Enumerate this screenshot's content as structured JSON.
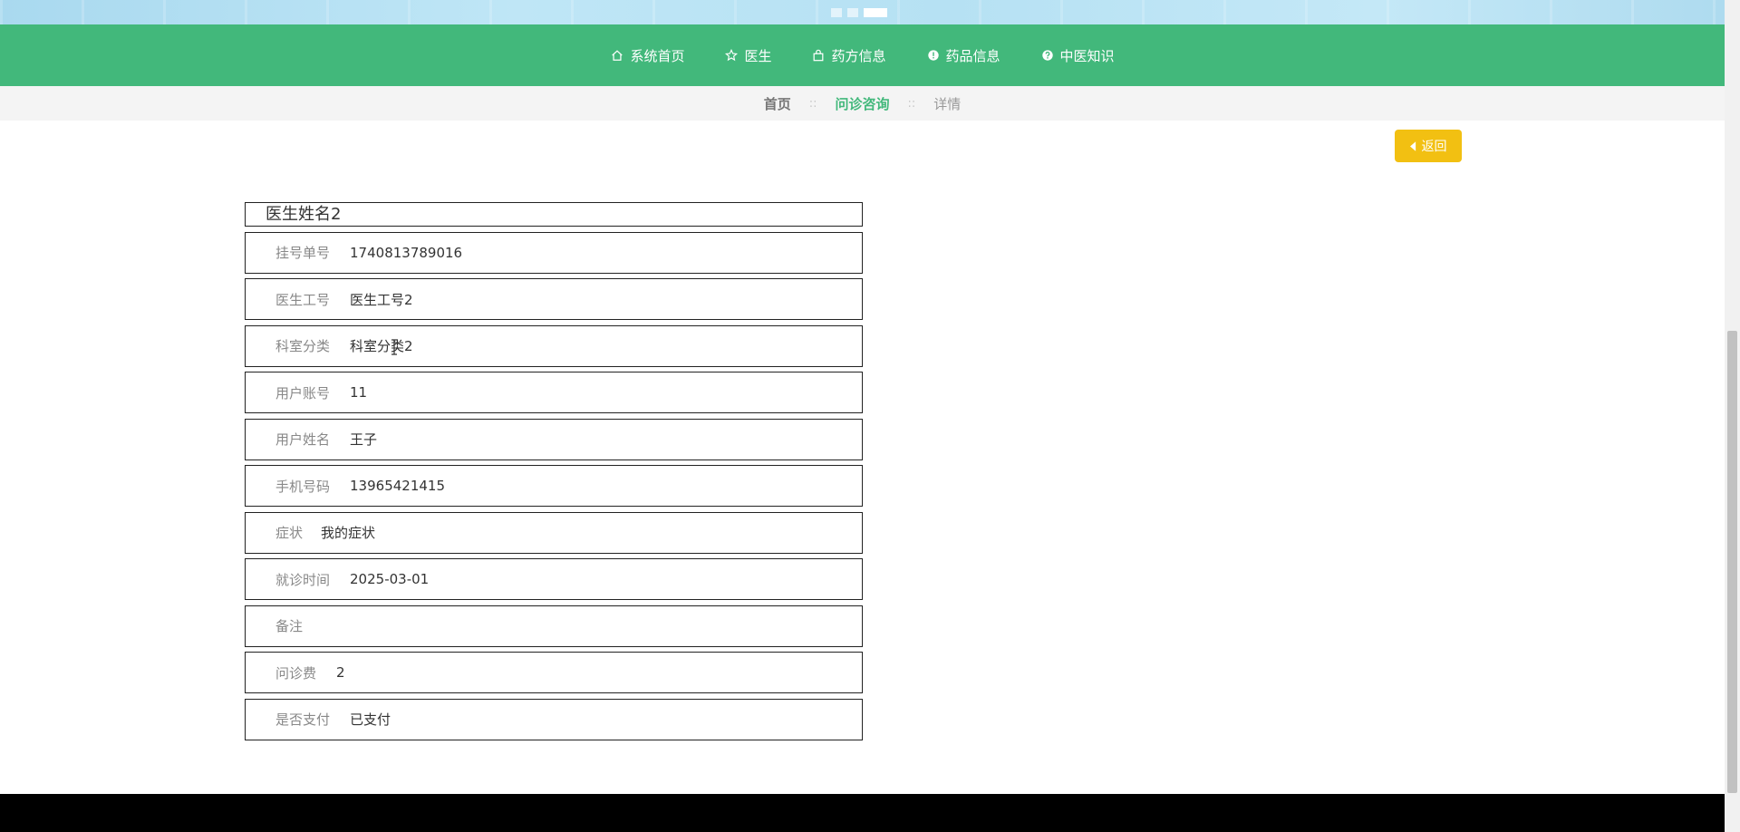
{
  "nav": {
    "items": [
      {
        "label": "系统首页",
        "icon": "home-icon"
      },
      {
        "label": "医生",
        "icon": "star-icon"
      },
      {
        "label": "药方信息",
        "icon": "bag-icon"
      },
      {
        "label": "药品信息",
        "icon": "exclamation-icon"
      },
      {
        "label": "中医知识",
        "icon": "question-icon"
      }
    ]
  },
  "breadcrumb": {
    "items": [
      "首页",
      "问诊咨询",
      "详情"
    ],
    "separator": "::"
  },
  "back_button": {
    "label": "返回"
  },
  "detail": {
    "title": "医生姓名2",
    "fields": [
      {
        "label": "挂号单号",
        "value": "1740813789016"
      },
      {
        "label": "医生工号",
        "value": "医生工号2"
      },
      {
        "label": "科室分类",
        "value": "科室分类2"
      },
      {
        "label": "用户账号",
        "value": "11"
      },
      {
        "label": "用户姓名",
        "value": "王子"
      },
      {
        "label": "手机号码",
        "value": "13965421415"
      },
      {
        "label": "症状",
        "value": "我的症状"
      },
      {
        "label": "就诊时间",
        "value": "2025-03-01"
      },
      {
        "label": "备注",
        "value": ""
      },
      {
        "label": "问诊费",
        "value": "2"
      },
      {
        "label": "是否支付",
        "value": "已支付"
      }
    ]
  },
  "colors": {
    "nav_bg": "#42b87b",
    "accent": "#42b87b",
    "back_button_bg": "#f2c012",
    "footer_bg": "#000000"
  }
}
